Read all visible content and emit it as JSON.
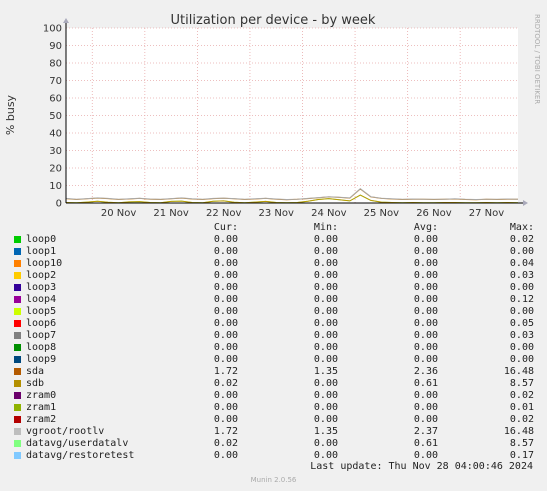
{
  "side_label": "RRDTOOL / TOBI OETIKER",
  "footer": "Munin 2.0.56",
  "last_update": "Last update: Thu Nov 28 04:00:46 2024",
  "headers": {
    "cur": "Cur:",
    "min": "Min:",
    "avg": "Avg:",
    "max": "Max:"
  },
  "chart_data": {
    "type": "line",
    "title": "Utilization per device - by week",
    "ylabel": "% busy",
    "xlabel": "",
    "ylim": [
      0,
      100
    ],
    "yticks": [
      "0",
      "10",
      "20",
      "30",
      "40",
      "50",
      "60",
      "70",
      "80",
      "90",
      "100"
    ],
    "xticks": [
      "20 Nov",
      "21 Nov",
      "22 Nov",
      "23 Nov",
      "24 Nov",
      "25 Nov",
      "26 Nov",
      "27 Nov"
    ],
    "grid": true,
    "x": [
      19.5,
      19.7,
      19.9,
      20.1,
      20.3,
      20.5,
      20.7,
      20.9,
      21.1,
      21.3,
      21.5,
      21.7,
      21.9,
      22.1,
      22.3,
      22.5,
      22.7,
      22.9,
      23.1,
      23.3,
      23.5,
      23.7,
      23.9,
      24.1,
      24.3,
      24.5,
      24.7,
      24.9,
      25.1,
      25.3,
      25.5,
      25.7,
      25.9,
      26.1,
      26.3,
      26.5,
      26.7,
      26.9,
      27.1,
      27.3,
      27.5,
      27.7,
      27.9,
      28.1
    ],
    "series": [
      {
        "name": "sda",
        "color": "#cc7700",
        "values": [
          2.5,
          2.0,
          2.4,
          2.8,
          2.5,
          2.0,
          2.3,
          2.6,
          2.2,
          2.0,
          2.4,
          2.8,
          2.3,
          2.0,
          2.5,
          2.7,
          2.4,
          2.0,
          2.3,
          2.6,
          2.2,
          1.9,
          2.1,
          2.5,
          3.0,
          3.5,
          3.2,
          2.8,
          8.0,
          3.5,
          2.6,
          2.3,
          2.0,
          2.2,
          2.1,
          2.0,
          2.1,
          2.3,
          2.0,
          1.9,
          2.1,
          2.0,
          2.2,
          2.1
        ]
      },
      {
        "name": "vgroot/rootlv",
        "color": "#aaaaaa",
        "values": [
          2.6,
          2.1,
          2.5,
          2.9,
          2.6,
          2.1,
          2.4,
          2.7,
          2.3,
          2.1,
          2.5,
          2.9,
          2.4,
          2.1,
          2.6,
          2.8,
          2.5,
          2.1,
          2.4,
          2.7,
          2.3,
          2.0,
          2.2,
          2.6,
          3.1,
          3.6,
          3.3,
          2.9,
          8.2,
          3.6,
          2.7,
          2.4,
          2.1,
          2.3,
          2.2,
          2.1,
          2.2,
          2.4,
          2.1,
          2.0,
          2.2,
          2.1,
          2.3,
          2.2
        ]
      },
      {
        "name": "datavg/userdatalv",
        "color": "#88ee88",
        "values": [
          0.3,
          0.2,
          0.5,
          1.0,
          0.4,
          0.2,
          0.6,
          0.8,
          0.3,
          0.2,
          0.9,
          1.1,
          0.3,
          0.2,
          1.0,
          1.2,
          0.4,
          0.2,
          0.5,
          0.9,
          0.3,
          0.2,
          0.3,
          1.0,
          2.0,
          2.5,
          1.8,
          1.2,
          4.5,
          1.5,
          0.5,
          0.3,
          0.2,
          0.3,
          0.2,
          0.2,
          0.3,
          0.3,
          0.2,
          0.2,
          0.3,
          0.2,
          0.3,
          0.2
        ]
      },
      {
        "name": "sdb",
        "color": "#bb9900",
        "values": [
          0.3,
          0.2,
          0.5,
          1.0,
          0.4,
          0.2,
          0.6,
          0.8,
          0.3,
          0.2,
          0.9,
          1.1,
          0.3,
          0.2,
          1.0,
          1.2,
          0.4,
          0.2,
          0.5,
          0.9,
          0.3,
          0.2,
          0.3,
          1.0,
          2.0,
          2.5,
          1.8,
          1.2,
          4.5,
          1.5,
          0.5,
          0.3,
          0.2,
          0.3,
          0.2,
          0.2,
          0.3,
          0.3,
          0.2,
          0.2,
          0.3,
          0.2,
          0.3,
          0.2
        ]
      }
    ]
  },
  "legend": [
    {
      "name": "loop0",
      "color": "#00cc00",
      "cur": "0.00",
      "min": "0.00",
      "avg": "0.00",
      "max": "0.02"
    },
    {
      "name": "loop1",
      "color": "#0066b3",
      "cur": "0.00",
      "min": "0.00",
      "avg": "0.00",
      "max": "0.00"
    },
    {
      "name": "loop10",
      "color": "#ff8000",
      "cur": "0.00",
      "min": "0.00",
      "avg": "0.00",
      "max": "0.04"
    },
    {
      "name": "loop2",
      "color": "#ffcc00",
      "cur": "0.00",
      "min": "0.00",
      "avg": "0.00",
      "max": "0.03"
    },
    {
      "name": "loop3",
      "color": "#330099",
      "cur": "0.00",
      "min": "0.00",
      "avg": "0.00",
      "max": "0.00"
    },
    {
      "name": "loop4",
      "color": "#990099",
      "cur": "0.00",
      "min": "0.00",
      "avg": "0.00",
      "max": "0.12"
    },
    {
      "name": "loop5",
      "color": "#ccff00",
      "cur": "0.00",
      "min": "0.00",
      "avg": "0.00",
      "max": "0.00"
    },
    {
      "name": "loop6",
      "color": "#ff0000",
      "cur": "0.00",
      "min": "0.00",
      "avg": "0.00",
      "max": "0.05"
    },
    {
      "name": "loop7",
      "color": "#808080",
      "cur": "0.00",
      "min": "0.00",
      "avg": "0.00",
      "max": "0.03"
    },
    {
      "name": "loop8",
      "color": "#008f00",
      "cur": "0.00",
      "min": "0.00",
      "avg": "0.00",
      "max": "0.00"
    },
    {
      "name": "loop9",
      "color": "#00487d",
      "cur": "0.00",
      "min": "0.00",
      "avg": "0.00",
      "max": "0.00"
    },
    {
      "name": "sda",
      "color": "#b35a00",
      "cur": "1.72",
      "min": "1.35",
      "avg": "2.36",
      "max": "16.48"
    },
    {
      "name": "sdb",
      "color": "#b38f00",
      "cur": "0.02",
      "min": "0.00",
      "avg": "0.61",
      "max": "8.57"
    },
    {
      "name": "zram0",
      "color": "#6b006b",
      "cur": "0.00",
      "min": "0.00",
      "avg": "0.00",
      "max": "0.02"
    },
    {
      "name": "zram1",
      "color": "#8fb300",
      "cur": "0.00",
      "min": "0.00",
      "avg": "0.00",
      "max": "0.01"
    },
    {
      "name": "zram2",
      "color": "#b30000",
      "cur": "0.00",
      "min": "0.00",
      "avg": "0.00",
      "max": "0.02"
    },
    {
      "name": "vgroot/rootlv",
      "color": "#bebebe",
      "cur": "1.72",
      "min": "1.35",
      "avg": "2.37",
      "max": "16.48"
    },
    {
      "name": "datavg/userdatalv",
      "color": "#80ff80",
      "cur": "0.02",
      "min": "0.00",
      "avg": "0.61",
      "max": "8.57"
    },
    {
      "name": "datavg/restoretest",
      "color": "#80c9ff",
      "cur": "0.00",
      "min": "0.00",
      "avg": "0.00",
      "max": "0.17"
    }
  ]
}
